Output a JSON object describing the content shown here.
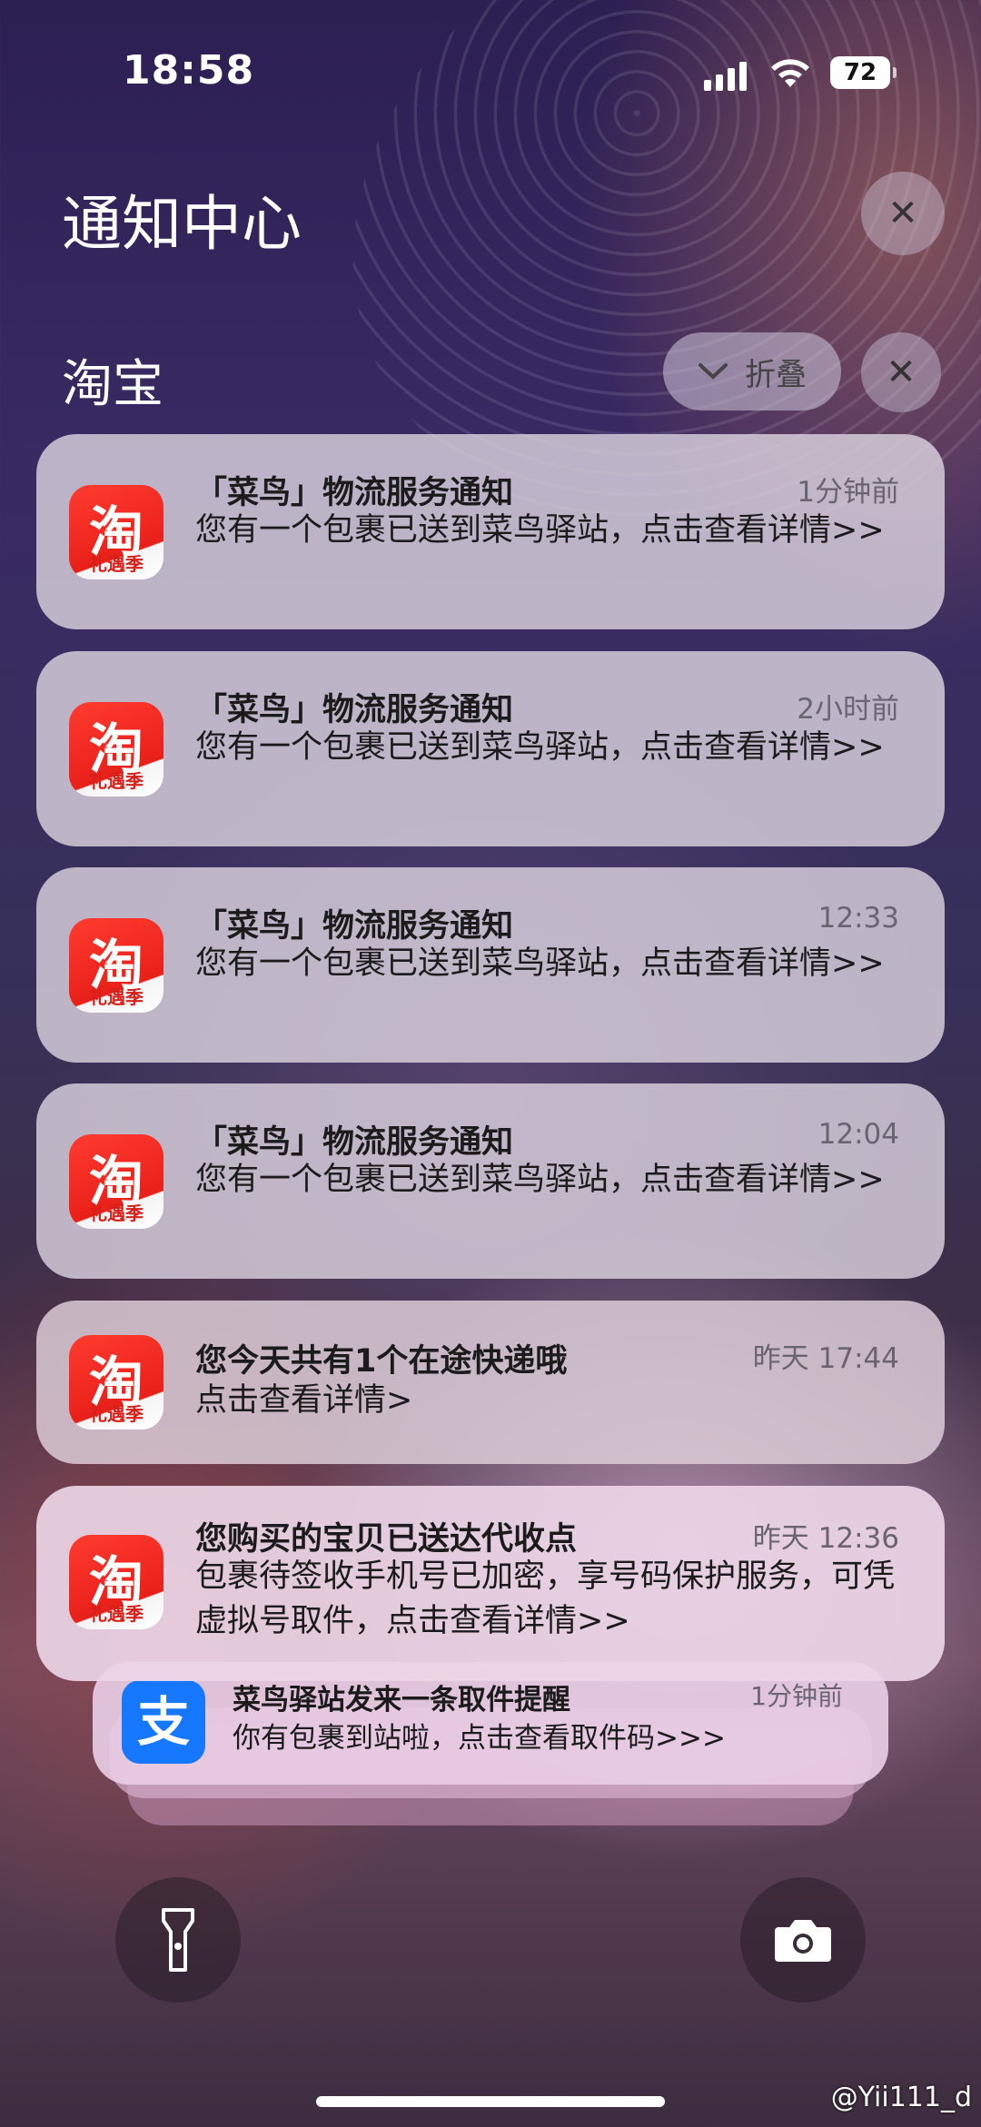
{
  "status": {
    "time": "18:58",
    "battery": "72"
  },
  "header": {
    "title": "通知中心",
    "clear_icon": "close-icon"
  },
  "group": {
    "title": "淘宝",
    "collapse_label": "折叠",
    "clear_icon": "close-icon"
  },
  "app_icon": {
    "glyph": "淘",
    "sub": "礼遇季"
  },
  "notifications": [
    {
      "title": "「菜鸟」物流服务通知",
      "time": "1分钟前",
      "body": "您有一个包裹已送到菜鸟驿站，点击查看详情>>"
    },
    {
      "title": "「菜鸟」物流服务通知",
      "time": "2小时前",
      "body": "您有一个包裹已送到菜鸟驿站，点击查看详情>>"
    },
    {
      "title": "「菜鸟」物流服务通知",
      "time": "12:33",
      "body": "您有一个包裹已送到菜鸟驿站，点击查看详情>>"
    },
    {
      "title": "「菜鸟」物流服务通知",
      "time": "12:04",
      "body": "您有一个包裹已送到菜鸟驿站，点击查看详情>>"
    },
    {
      "title": "您今天共有1个在途快递哦",
      "time": "昨天 17:44",
      "body": "点击查看详情>"
    },
    {
      "title": "您购买的宝贝已送达代收点",
      "time": "昨天 12:36",
      "body": "包裹待签收手机号已加密，享号码保护服务，可凭虚拟号取件，点击查看详情>>"
    }
  ],
  "stacked": {
    "icon_glyph": "支",
    "title": "菜鸟驿站发来一条取件提醒",
    "time": "1分钟前",
    "body": "你有包裹到站啦，点击查看取件码>>>"
  },
  "bottom": {
    "left_icon": "flashlight-icon",
    "right_icon": "camera-icon"
  },
  "watermark": "@Yii111_d"
}
